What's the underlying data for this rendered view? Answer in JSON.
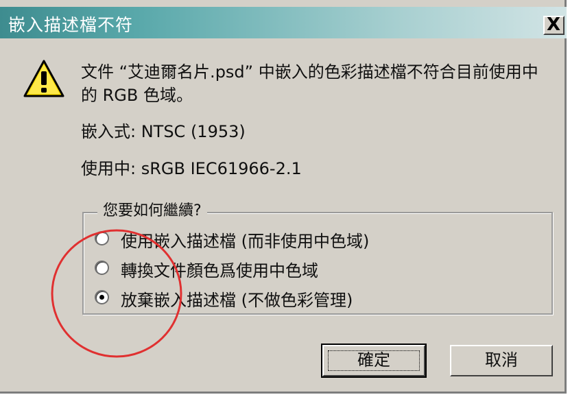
{
  "dialog": {
    "title": "嵌入描述檔不符",
    "close_label": "X"
  },
  "message": {
    "line1": "文件 “艾迪爾名片.psd” 中嵌入的色彩描述檔不符合目前使用中",
    "line2": "的 RGB 色域。",
    "embedded": "嵌入式: NTSC (1953)",
    "working": "使用中: sRGB IEC61966-2.1"
  },
  "options": {
    "legend": "您要如何繼續?",
    "items": [
      {
        "label": "使用嵌入描述檔 (而非使用中色域)",
        "checked": false
      },
      {
        "label": "轉換文件顏色爲使用中色域",
        "checked": false
      },
      {
        "label": "放棄嵌入描述檔 (不做色彩管理)",
        "checked": true
      }
    ]
  },
  "buttons": {
    "ok": "確定",
    "cancel": "取消"
  },
  "icons": {
    "warning": "warning-icon",
    "close": "close-icon"
  },
  "colors": {
    "dialog_bg": "#d4d0c8",
    "title_start": "#3e8c8f",
    "annotation_circle": "#e03030"
  }
}
